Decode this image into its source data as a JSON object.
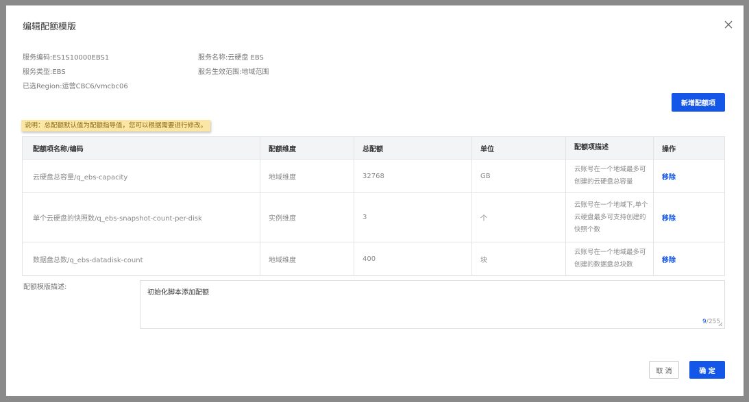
{
  "dialog": {
    "title": "编辑配额模版"
  },
  "meta": {
    "service_code": "服务编码:ES1S10000EBS1",
    "service_name": "服务名称:云硬盘 EBS",
    "service_type": "服务类型:EBS",
    "service_scope": "服务生效范围:地域范围",
    "region": "已选Region:运营CBC6/vmcbc06"
  },
  "actions": {
    "add_quota_item": "新增配额项",
    "cancel": "取 消",
    "confirm": "确 定"
  },
  "notice": "说明：总配额默认值为配额指导值，您可以根据需要进行修改。",
  "table": {
    "columns": [
      "配额项名称/编码",
      "配额维度",
      "总配额",
      "单位",
      "配额项描述",
      "操作"
    ],
    "rows": [
      {
        "name": "云硬盘总容量/q_ebs-capacity",
        "dimension": "地域维度",
        "total": "32768",
        "unit": "GB",
        "description": "云账号在一个地域最多可创建的云硬盘总容量",
        "action": "移除"
      },
      {
        "name": "单个云硬盘的快照数/q_ebs-snapshot-count-per-disk",
        "dimension": "实例维度",
        "total": "3",
        "unit": "个",
        "description": "云账号在一个地域下,单个云硬盘最多可支持创建的快照个数",
        "action": "移除"
      },
      {
        "name": "数据盘总数/q_ebs-datadisk-count",
        "dimension": "地域维度",
        "total": "400",
        "unit": "块",
        "description": "云账号在一个地域最多可创建的数据盘总块数",
        "action": "移除"
      }
    ]
  },
  "template_desc": {
    "label": "配额模版描述:",
    "value": "初始化脚本添加配额",
    "count": "9",
    "max": "/255"
  },
  "icons": {
    "close": "close-icon",
    "resize": "resize-handle-icon"
  },
  "colors": {
    "primary": "#1356e8",
    "notice_bg": "#fbe6a6"
  }
}
